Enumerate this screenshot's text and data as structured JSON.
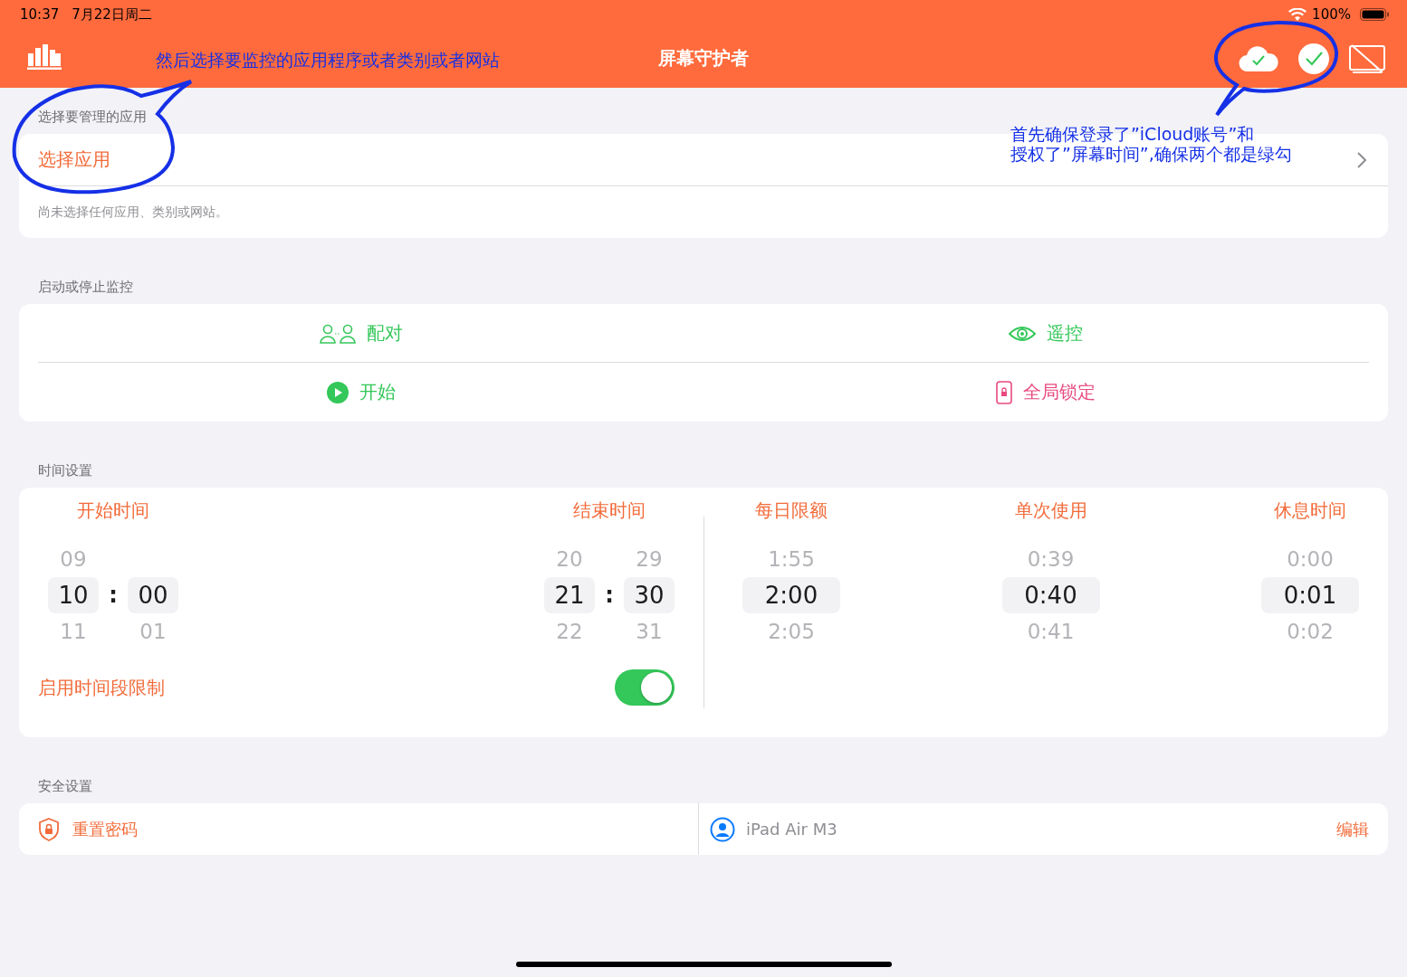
{
  "status_bar": {
    "time": "10:37",
    "date": "7月22日周二",
    "battery": "100%"
  },
  "nav": {
    "title": "屏幕守护者",
    "status_icons": [
      {
        "kind": "cloud",
        "ok": true
      },
      {
        "kind": "auth",
        "ok": true
      }
    ]
  },
  "annotations": [
    {
      "lines": [
        "然后选择要监控的应用程序或者类别或者网站"
      ]
    },
    {
      "lines": [
        "首先确保登录了”iCloud账号”和",
        "授权了”屏幕时间”,确保两个都是绿勾"
      ]
    }
  ],
  "app_section": {
    "header": "选择要管理的应用",
    "button": "选择应用",
    "hint": "尚未选择任何应用、类别或网站。"
  },
  "monitor_section": {
    "header": "启动或停止监控",
    "actions": [
      {
        "kind": "pair",
        "label": "配对",
        "color": "#34c759"
      },
      {
        "kind": "remote",
        "label": "遥控",
        "color": "#34c759"
      },
      {
        "kind": "start",
        "label": "开始",
        "color": "#34c759"
      },
      {
        "kind": "lock",
        "label": "全局锁定",
        "color": "#e84a7f"
      }
    ]
  },
  "time_section": {
    "header": "时间设置",
    "ranges": [
      {
        "label": "开始时间",
        "hours": {
          "above": "09",
          "value": "10",
          "below": "11"
        },
        "separator": ":",
        "minutes": {
          "value": "00",
          "below": "01"
        }
      },
      {
        "label": "结束时间",
        "hours": {
          "above": "20",
          "value": "21",
          "below": "22"
        },
        "separator": ":",
        "minutes": {
          "above": "29",
          "value": "30",
          "below": "31"
        }
      }
    ],
    "toggle": {
      "label": "启用时间段限制",
      "on": true
    },
    "limits": [
      {
        "label": "每日限额",
        "values": [
          "1:55",
          "2:00",
          "2:05"
        ]
      },
      {
        "label": "单次使用",
        "values": [
          "0:39",
          "0:40",
          "0:41"
        ]
      },
      {
        "label": "休息时间",
        "values": [
          "0:00",
          "0:01",
          "0:02"
        ]
      }
    ]
  },
  "security_section": {
    "header": "安全设置",
    "reset": "重置密码",
    "device": "iPad Air M3",
    "edit": "编辑"
  }
}
